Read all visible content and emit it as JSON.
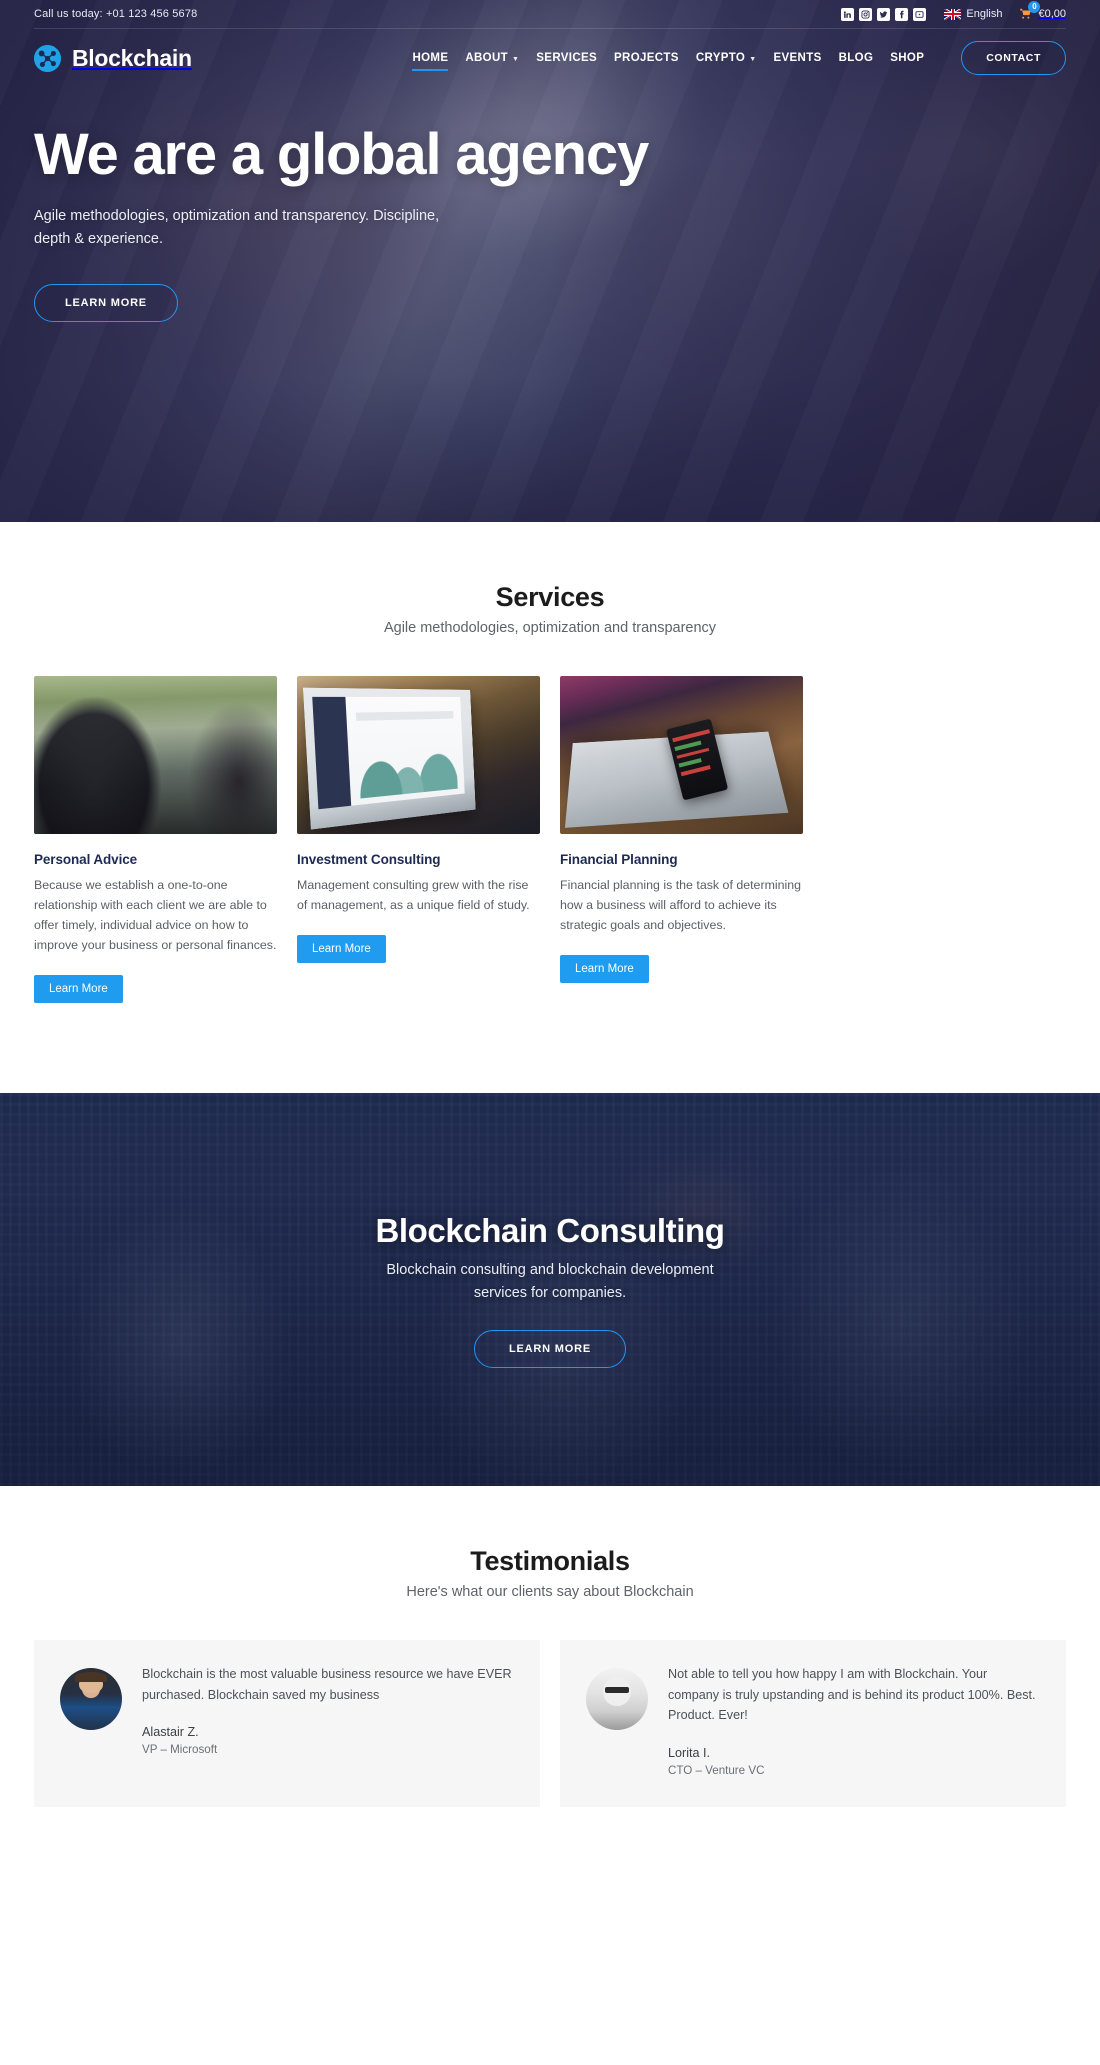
{
  "topbar": {
    "phone_label": "Call us today: +01 123 456 5678",
    "social": [
      {
        "name": "linkedin-icon",
        "glyph": "in"
      },
      {
        "name": "instagram-icon",
        "glyph": "◉"
      },
      {
        "name": "twitter-icon",
        "glyph": "t"
      },
      {
        "name": "facebook-icon",
        "glyph": "f"
      },
      {
        "name": "youtube-icon",
        "glyph": "▶"
      }
    ],
    "language": "English",
    "flag": "uk-flag-icon",
    "cart_count": "0",
    "cart_amount": "€0,00"
  },
  "brand": {
    "name": "Blockchain",
    "logo": "blockchain-network-logo"
  },
  "nav": {
    "items": [
      {
        "label": "HOME",
        "active": true,
        "dropdown": false
      },
      {
        "label": "ABOUT",
        "active": false,
        "dropdown": true
      },
      {
        "label": "SERVICES",
        "active": false,
        "dropdown": false
      },
      {
        "label": "PROJECTS",
        "active": false,
        "dropdown": false
      },
      {
        "label": "CRYPTO",
        "active": false,
        "dropdown": true
      },
      {
        "label": "EVENTS",
        "active": false,
        "dropdown": false
      },
      {
        "label": "BLOG",
        "active": false,
        "dropdown": false
      },
      {
        "label": "SHOP",
        "active": false,
        "dropdown": false
      }
    ],
    "contact_label": "CONTACT"
  },
  "hero": {
    "title": "We are a global agency",
    "subtitle": "Agile methodologies, optimization and transparency. Discipline, depth & experience.",
    "button_label": "LEARN MORE"
  },
  "services": {
    "title": "Services",
    "subtitle": "Agile methodologies, optimization and transparency",
    "cards": [
      {
        "image": "two-people-meeting-with-laptop-photo",
        "title": "Personal Advice",
        "text": "Because we establish a one-to-one relationship with each client we are able to offer timely, individual advice on how to improve your business or personal finances.",
        "button_label": "Learn More"
      },
      {
        "image": "laptop-analytics-dashboard-photo",
        "title": "Investment Consulting",
        "text": "Management consulting grew with the rise of management, as a unique field of study.",
        "button_label": "Learn More"
      },
      {
        "image": "hands-holding-phone-over-laptop-photo",
        "title": "Financial Planning",
        "text": "Financial planning is the task of determining how a business will afford to achieve its strategic goals and objectives.",
        "button_label": "Learn More"
      }
    ]
  },
  "cta": {
    "title": "Blockchain Consulting",
    "subtitle": "Blockchain consulting and blockchain development services for companies.",
    "button_label": "LEARN MORE",
    "background": "city-skyline-night-photo"
  },
  "testimonials": {
    "title": "Testimonials",
    "subtitle": "Here's what our clients say about Blockchain",
    "items": [
      {
        "avatar": "man-in-suit-avatar",
        "quote": "Blockchain is the most valuable business resource we have EVER purchased. Blockchain saved my business",
        "name": "Alastair Z.",
        "role": "VP – Microsoft"
      },
      {
        "avatar": "woman-with-glasses-avatar",
        "quote": "Not able to tell you how happy I am with Blockchain. Your company is truly upstanding and is behind its product 100%. Best. Product. Ever!",
        "name": "Lorita I.",
        "role": "CTO – Venture VC"
      }
    ]
  },
  "colors": {
    "accent": "#2196f3",
    "button": "#1f9bf0",
    "heading_dark": "#1e2a52",
    "hero_bg": "#2b2c4e"
  }
}
